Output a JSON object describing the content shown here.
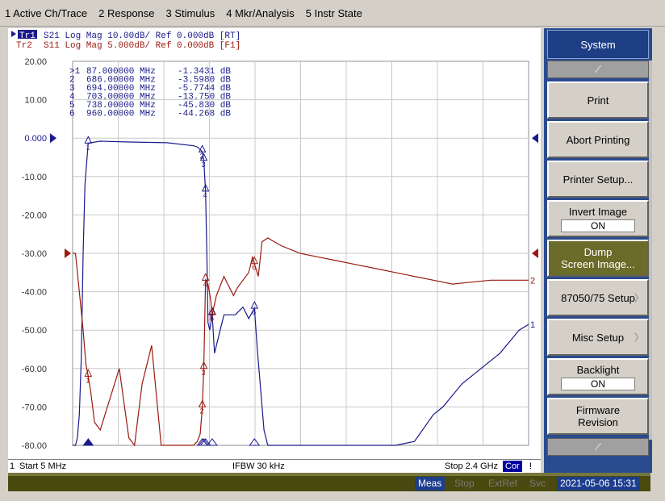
{
  "menu": [
    "1 Active Ch/Trace",
    "2 Response",
    "3 Stimulus",
    "4 Mkr/Analysis",
    "5 Instr State"
  ],
  "traces": {
    "tr1": {
      "label": "Tr1",
      "text": "S21 Log Mag 10.00dB/ Ref 0.000dB [RT]",
      "color": "#1a1a8c"
    },
    "tr2": {
      "label": "Tr2",
      "text": "S11 Log Mag 5.000dB/ Ref 0.000dB [F1]",
      "color": "#9a1a10"
    }
  },
  "markers": [
    {
      "num": ">1",
      "freq": "87.000000 MHz",
      "value": "-1.3431 dB"
    },
    {
      "num": "2",
      "freq": "686.00000 MHz",
      "value": "-3.5980 dB"
    },
    {
      "num": "3",
      "freq": "694.00000 MHz",
      "value": "-5.7744 dB"
    },
    {
      "num": "4",
      "freq": "703.00000 MHz",
      "value": "-13.750 dB"
    },
    {
      "num": "5",
      "freq": "738.00000 MHz",
      "value": "-45.830 dB"
    },
    {
      "num": "6",
      "freq": "960.00000 MHz",
      "value": "-44.268 dB"
    }
  ],
  "y_tick_labels": [
    "20.00",
    "10.00",
    "0.000",
    "-10.00",
    "-20.00",
    "-30.00",
    "-40.00",
    "-50.00",
    "-60.00",
    "-70.00",
    "-80.00"
  ],
  "chart_data": {
    "type": "line",
    "x_range_mhz": [
      5,
      2400
    ],
    "ylim_db": [
      -80,
      20
    ],
    "grid": true,
    "series": [
      {
        "name": "S21",
        "color": "#1a1a8c",
        "x": [
          5,
          20,
          30,
          40,
          50,
          55,
          60,
          70,
          87,
          150,
          300,
          500,
          640,
          660,
          675,
          686,
          694,
          703,
          710,
          716,
          725,
          738,
          750,
          780,
          800,
          860,
          900,
          930,
          960,
          975,
          990,
          1010,
          1030,
          1060,
          1100,
          1150,
          1200,
          1300,
          1400,
          1500,
          1600,
          1700,
          1800,
          1900,
          1950,
          2000,
          2050,
          2100,
          2150,
          2200,
          2250,
          2300,
          2350,
          2400
        ],
        "y": [
          -80,
          -80,
          -78,
          -72,
          -58,
          -45,
          -30,
          -12,
          -1.3,
          -0.8,
          -1.0,
          -1.2,
          -2.0,
          -2.3,
          -3.0,
          -3.6,
          -5.8,
          -13.8,
          -30,
          -48,
          -50,
          -45.8,
          -56,
          -50,
          -46,
          -46,
          -44,
          -47,
          -44.3,
          -55,
          -64,
          -76,
          -80,
          -80,
          -80,
          -80,
          -80,
          -80,
          -80,
          -80,
          -80,
          -80,
          -79,
          -72,
          -70,
          -67,
          -64,
          -62,
          -60,
          -58,
          -56,
          -53,
          -50,
          -48.5
        ]
      },
      {
        "name": "S11",
        "color": "#9a1a10",
        "x": [
          5,
          20,
          40,
          60,
          75,
          87,
          100,
          120,
          150,
          200,
          250,
          300,
          330,
          370,
          420,
          470,
          520,
          560,
          600,
          640,
          660,
          675,
          686,
          694,
          703,
          716,
          730,
          738,
          760,
          800,
          850,
          870,
          900,
          930,
          950,
          980,
          1000,
          1030,
          1100,
          1200,
          1300,
          1400,
          1500,
          1600,
          1700,
          1800,
          1900,
          2000,
          2100,
          2200,
          2300,
          2400
        ],
        "y": [
          -30,
          -30,
          -40,
          -50,
          -59,
          -62,
          -66,
          -74,
          -76,
          -68,
          -60,
          -78,
          -80,
          -64,
          -54,
          -80,
          -80,
          -80,
          -80,
          -80,
          -79,
          -77,
          -70,
          -60,
          -37,
          -38,
          -42,
          -46,
          -41,
          -36,
          -41,
          -39,
          -37,
          -35,
          -31,
          -36,
          -27,
          -26,
          -28,
          -30,
          -31,
          -32,
          -33,
          -34,
          -35,
          -36,
          -37,
          -38,
          -37.5,
          -37,
          -37,
          -37
        ]
      }
    ]
  },
  "trace_end_labels": [
    "2",
    "1"
  ],
  "bottom": {
    "index": "1",
    "start": "Start 5 MHz",
    "ifbw": "IFBW 30 kHz",
    "stop": "Stop 2.4 GHz",
    "cor": "Cor",
    "bang": "!"
  },
  "status": {
    "meas": "Meas",
    "stop": "Stop",
    "extref": "ExtRef",
    "svc": "Svc",
    "datetime": "2021-05-06 15:31"
  },
  "softkeys": {
    "title": "System",
    "print": "Print",
    "abort": "Abort Printing",
    "printer_setup": "Printer Setup...",
    "invert_image": "Invert Image",
    "invert_state": "ON",
    "dump1": "Dump",
    "dump2": "Screen Image...",
    "setup_87050": "87050/75 Setup",
    "misc": "Misc Setup",
    "backlight": "Backlight",
    "backlight_state": "ON",
    "firmware1": "Firmware",
    "firmware2": "Revision"
  }
}
